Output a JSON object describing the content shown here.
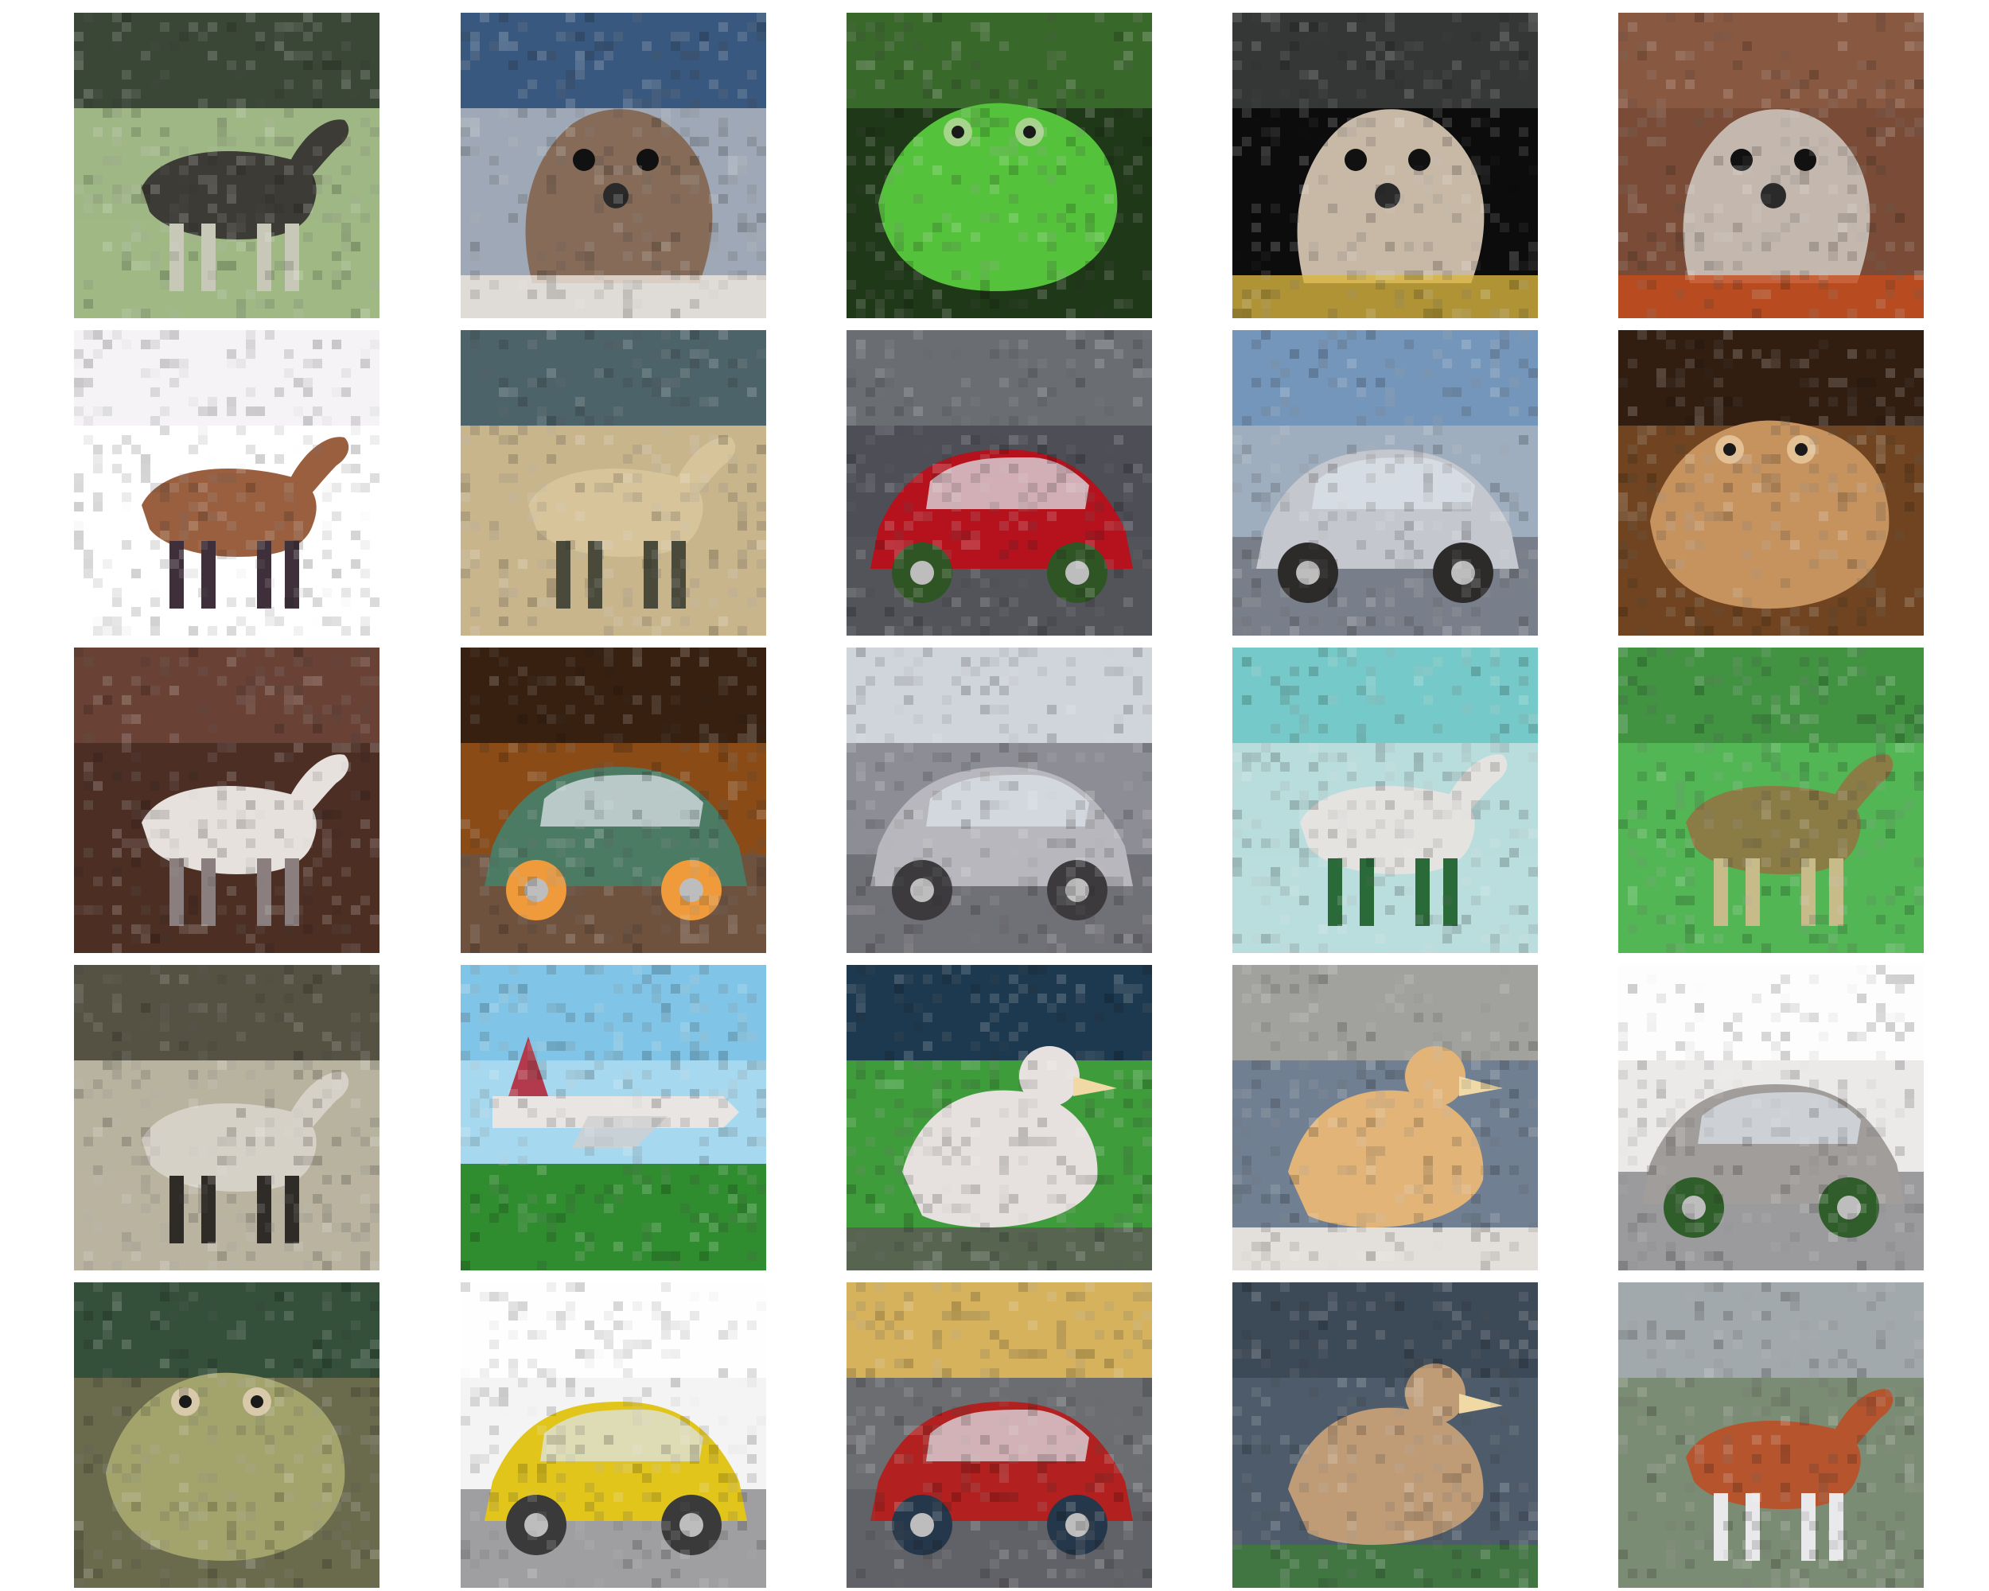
{
  "images": [
    [
      {
        "subject": "deer",
        "colors": {
          "bg": "#9fb784",
          "top": "#2f3b2f",
          "main": "#3c3b35",
          "accent": "#c8c8b8"
        }
      },
      {
        "subject": "cat",
        "colors": {
          "bg": "#9ea8b6",
          "top": "#2d4f79",
          "main": "#866b58",
          "accent": "#efe7df"
        }
      },
      {
        "subject": "frog",
        "colors": {
          "bg": "#1f3817",
          "top": "#3b6e2c",
          "main": "#55c23b",
          "accent": "#a7d48c"
        }
      },
      {
        "subject": "dog",
        "colors": {
          "bg": "#0c0c0c",
          "top": "#3a3b3b",
          "main": "#c8b9a7",
          "accent": "#d8b53e"
        }
      },
      {
        "subject": "cat",
        "colors": {
          "bg": "#7a4b36",
          "top": "#8b5a41",
          "main": "#c4b7ad",
          "accent": "#c84b1b"
        }
      }
    ],
    [
      {
        "subject": "horse",
        "colors": {
          "bg": "#ffffff",
          "top": "#f4f2f5",
          "main": "#9a5f3f",
          "accent": "#3e2f3a"
        }
      },
      {
        "subject": "deer",
        "colors": {
          "bg": "#c9b58c",
          "top": "#3e5a65",
          "main": "#d8c49a",
          "accent": "#4a4a3a"
        }
      },
      {
        "subject": "automobile",
        "colors": {
          "bg": "#4d4e56",
          "top": "#6e7277",
          "main": "#b5121d",
          "accent": "#2f5524"
        }
      },
      {
        "subject": "automobile",
        "colors": {
          "bg": "#9faebf",
          "top": "#6f94b9",
          "main": "#c4c7ce",
          "accent": "#2d2a2a"
        }
      },
      {
        "subject": "frog",
        "colors": {
          "bg": "#704420",
          "top": "#2b1b0f",
          "main": "#c6935f",
          "accent": "#e3c194"
        }
      }
    ],
    [
      {
        "subject": "horse",
        "colors": {
          "bg": "#4d2e24",
          "top": "#6e4437",
          "main": "#e7e1dd",
          "accent": "#8a7f7e"
        }
      },
      {
        "subject": "automobile",
        "colors": {
          "bg": "#8a4b17",
          "top": "#2d1c10",
          "main": "#4c7b63",
          "accent": "#f09b3b"
        }
      },
      {
        "subject": "truck",
        "colors": {
          "bg": "#8d8d95",
          "top": "#d7dbe2",
          "main": "#b7b7bd",
          "accent": "#3c3a3d"
        }
      },
      {
        "subject": "horse",
        "colors": {
          "bg": "#b9dddd",
          "top": "#6fc7c6",
          "main": "#e4e3e0",
          "accent": "#2a6a39"
        }
      },
      {
        "subject": "deer",
        "colors": {
          "bg": "#51b653",
          "top": "#3f8f3f",
          "main": "#8b7b45",
          "accent": "#c8bb8a"
        }
      }
    ],
    [
      {
        "subject": "horse",
        "colors": {
          "bg": "#b8b39f",
          "top": "#4a4739",
          "main": "#d6d1c6",
          "accent": "#2f2b27"
        }
      },
      {
        "subject": "airplane",
        "colors": {
          "bg": "#a6d8ef",
          "top": "#7cc3e6",
          "main": "#e8e5e3",
          "accent": "#2f8d2f"
        }
      },
      {
        "subject": "bird",
        "colors": {
          "bg": "#3e9c3b",
          "top": "#1a2f52",
          "main": "#e6e1de",
          "accent": "#5b5b55"
        }
      },
      {
        "subject": "bird",
        "colors": {
          "bg": "#707f91",
          "top": "#a6a59e",
          "main": "#e2b477",
          "accent": "#f7f0e6"
        }
      },
      {
        "subject": "truck",
        "colors": {
          "bg": "#ece9e9",
          "top": "#ffffff",
          "main": "#a19d9b",
          "accent": "#2f5e2a"
        }
      }
    ],
    [
      {
        "subject": "frog",
        "colors": {
          "bg": "#6a6a4d",
          "top": "#2f4c39",
          "main": "#a3a46c",
          "accent": "#d7c9a9"
        }
      },
      {
        "subject": "automobile",
        "colors": {
          "bg": "#f4f4f4",
          "top": "#ffffff",
          "main": "#e2c51b",
          "accent": "#3a3a3a"
        }
      },
      {
        "subject": "automobile",
        "colors": {
          "bg": "#6c6d71",
          "top": "#e2b95a",
          "main": "#b2201f",
          "accent": "#25374a"
        }
      },
      {
        "subject": "bird",
        "colors": {
          "bg": "#4d5b6a",
          "top": "#3b4755",
          "main": "#bf9b76",
          "accent": "#3f7b3c"
        }
      },
      {
        "subject": "deer",
        "colors": {
          "bg": "#7b8c74",
          "top": "#a6acb2",
          "main": "#b5542d",
          "accent": "#e9e9ec"
        }
      }
    ]
  ]
}
